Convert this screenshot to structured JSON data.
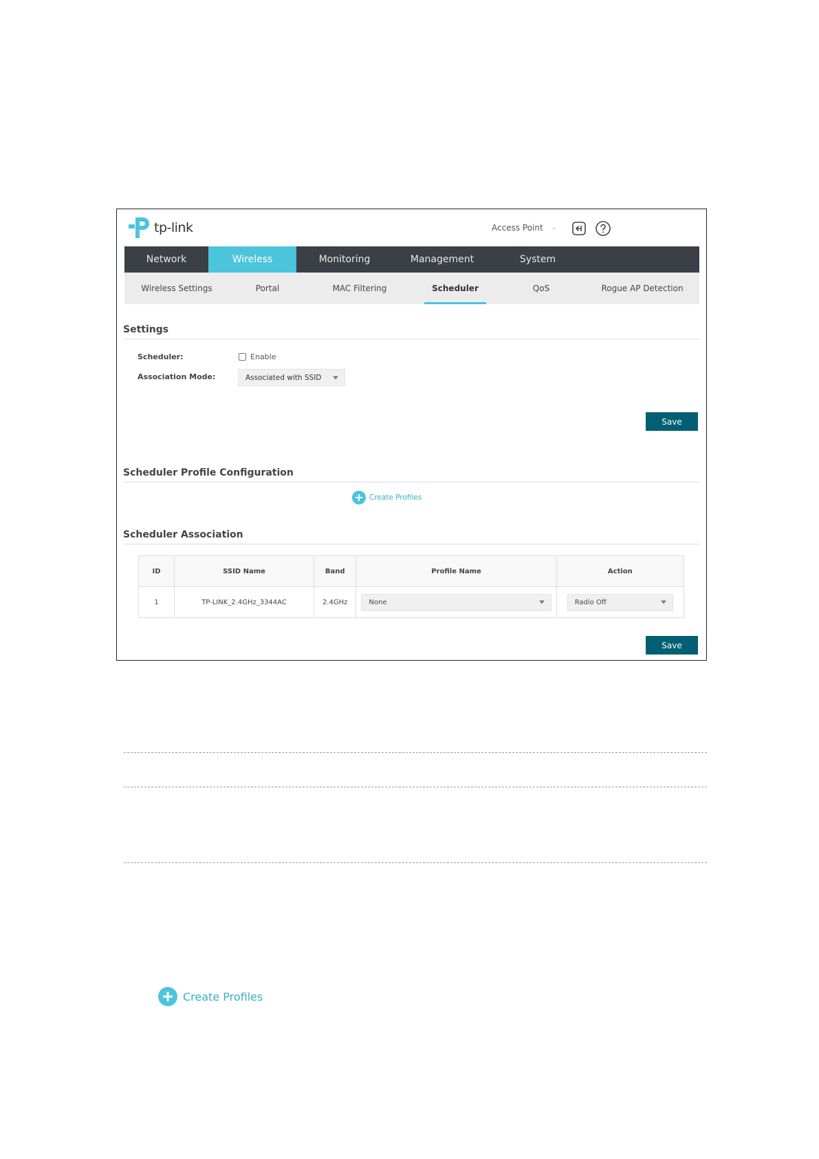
{
  "brand": {
    "name": "tp-link",
    "primary_color": "#4cc4dc",
    "button_color": "#005f73",
    "nav_color": "#3a4046"
  },
  "header": {
    "mode": "Access Point",
    "logout_icon": "logout-icon",
    "help_icon": "help-icon"
  },
  "main_nav": {
    "items": [
      {
        "label": "Network"
      },
      {
        "label": "Wireless",
        "active": true
      },
      {
        "label": "Monitoring"
      },
      {
        "label": "Management"
      },
      {
        "label": "System"
      }
    ]
  },
  "sub_nav": {
    "items": [
      {
        "label": "Wireless Settings"
      },
      {
        "label": "Portal"
      },
      {
        "label": "MAC Filtering"
      },
      {
        "label": "Scheduler",
        "active": true
      },
      {
        "label": "QoS"
      },
      {
        "label": "Rogue AP Detection"
      }
    ]
  },
  "settings": {
    "title": "Settings",
    "scheduler_label": "Scheduler:",
    "enable_label": "Enable",
    "enabled": false,
    "association_mode_label": "Association Mode:",
    "association_mode_value": "Associated with SSID",
    "save_label": "Save"
  },
  "profile_config": {
    "title": "Scheduler Profile Configuration",
    "create_label": "Create Profiles"
  },
  "association": {
    "title": "Scheduler Association",
    "columns": [
      "ID",
      "SSID Name",
      "Band",
      "Profile Name",
      "Action"
    ],
    "rows": [
      {
        "id": "1",
        "ssid": "TP-LINK_2.4GHz_3344AC",
        "band": "2.4GHz",
        "profile": "None",
        "action": "Radio Off"
      }
    ],
    "save_label": "Save"
  },
  "standalone_create": {
    "label": "Create Profiles"
  }
}
